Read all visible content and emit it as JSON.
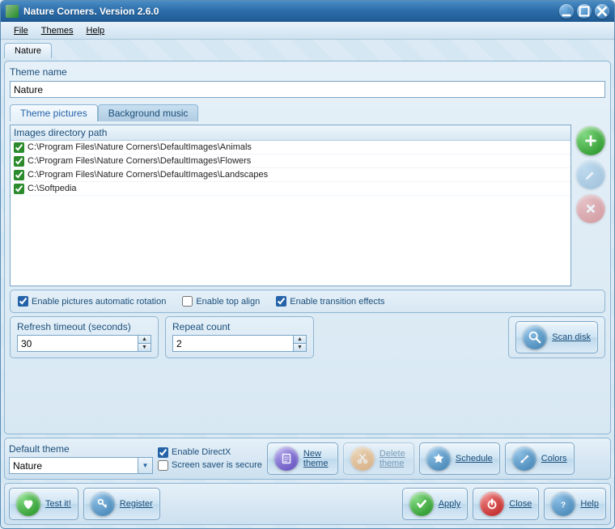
{
  "window": {
    "title": "Nature Corners. Version 2.6.0"
  },
  "menu": {
    "file": "File",
    "themes": "Themes",
    "help": "Help"
  },
  "main_tab": "Nature",
  "theme_name": {
    "label": "Theme name",
    "value": "Nature"
  },
  "tabs": {
    "pictures": "Theme pictures",
    "music": "Background music"
  },
  "list": {
    "header": "Images directory path",
    "items": [
      {
        "checked": true,
        "path": "C:\\Program Files\\Nature Corners\\DefaultImages\\Animals"
      },
      {
        "checked": true,
        "path": "C:\\Program Files\\Nature Corners\\DefaultImages\\Flowers"
      },
      {
        "checked": true,
        "path": "C:\\Program Files\\Nature Corners\\DefaultImages\\Landscapes"
      },
      {
        "checked": true,
        "path": "C:\\Softpedia"
      }
    ]
  },
  "options": {
    "rotation": {
      "label": "Enable pictures automatic rotation",
      "checked": true
    },
    "topalign": {
      "label": "Enable top align",
      "checked": false
    },
    "transition": {
      "label": "Enable transition effects",
      "checked": true
    }
  },
  "refresh": {
    "label": "Refresh timeout (seconds)",
    "value": "30"
  },
  "repeat": {
    "label": "Repeat count",
    "value": "2"
  },
  "scan": "Scan disk",
  "default_theme": {
    "label": "Default theme",
    "value": "Nature"
  },
  "directx": {
    "label": "Enable DirectX",
    "checked": true
  },
  "secure": {
    "label": "Screen saver is secure",
    "checked": false
  },
  "buttons": {
    "newtheme": "New theme",
    "deletetheme": "Delete theme",
    "schedule": "Schedule",
    "colors": "Colors",
    "testit": "Test it!",
    "register": "Register",
    "apply": "Apply",
    "close": "Close",
    "help": "Help"
  }
}
